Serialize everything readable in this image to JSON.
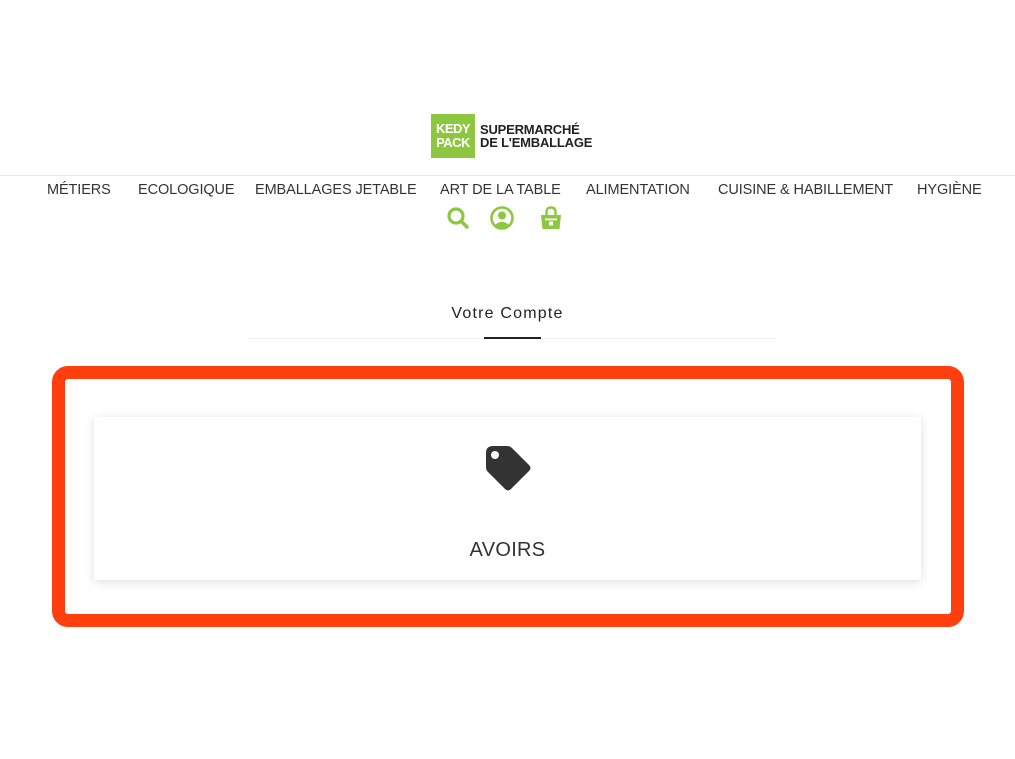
{
  "brand": {
    "mark_line1": "KEDY",
    "mark_line2": "PACK",
    "name_line1": "SUPERMARCHÉ",
    "name_line2": "DE L'EMBALLAGE",
    "color": "#8dc63f"
  },
  "nav": {
    "items": [
      {
        "label": "MÉTIERS"
      },
      {
        "label": "ECOLOGIQUE"
      },
      {
        "label": "EMBALLAGES JETABLE"
      },
      {
        "label": "ART DE LA TABLE"
      },
      {
        "label": "ALIMENTATION"
      },
      {
        "label": "CUISINE & HABILLEMENT"
      },
      {
        "label": "HYGIÈNE"
      }
    ]
  },
  "header_icons": [
    "search-icon",
    "user-account-icon",
    "shopping-bag-icon"
  ],
  "page": {
    "title": "Votre Compte"
  },
  "account": {
    "cards": [
      {
        "label": "AVOIRS",
        "icon": "tag-icon"
      }
    ]
  },
  "colors": {
    "accent": "#8dc63f",
    "highlight": "#ff3f0e",
    "text": "#333333"
  }
}
